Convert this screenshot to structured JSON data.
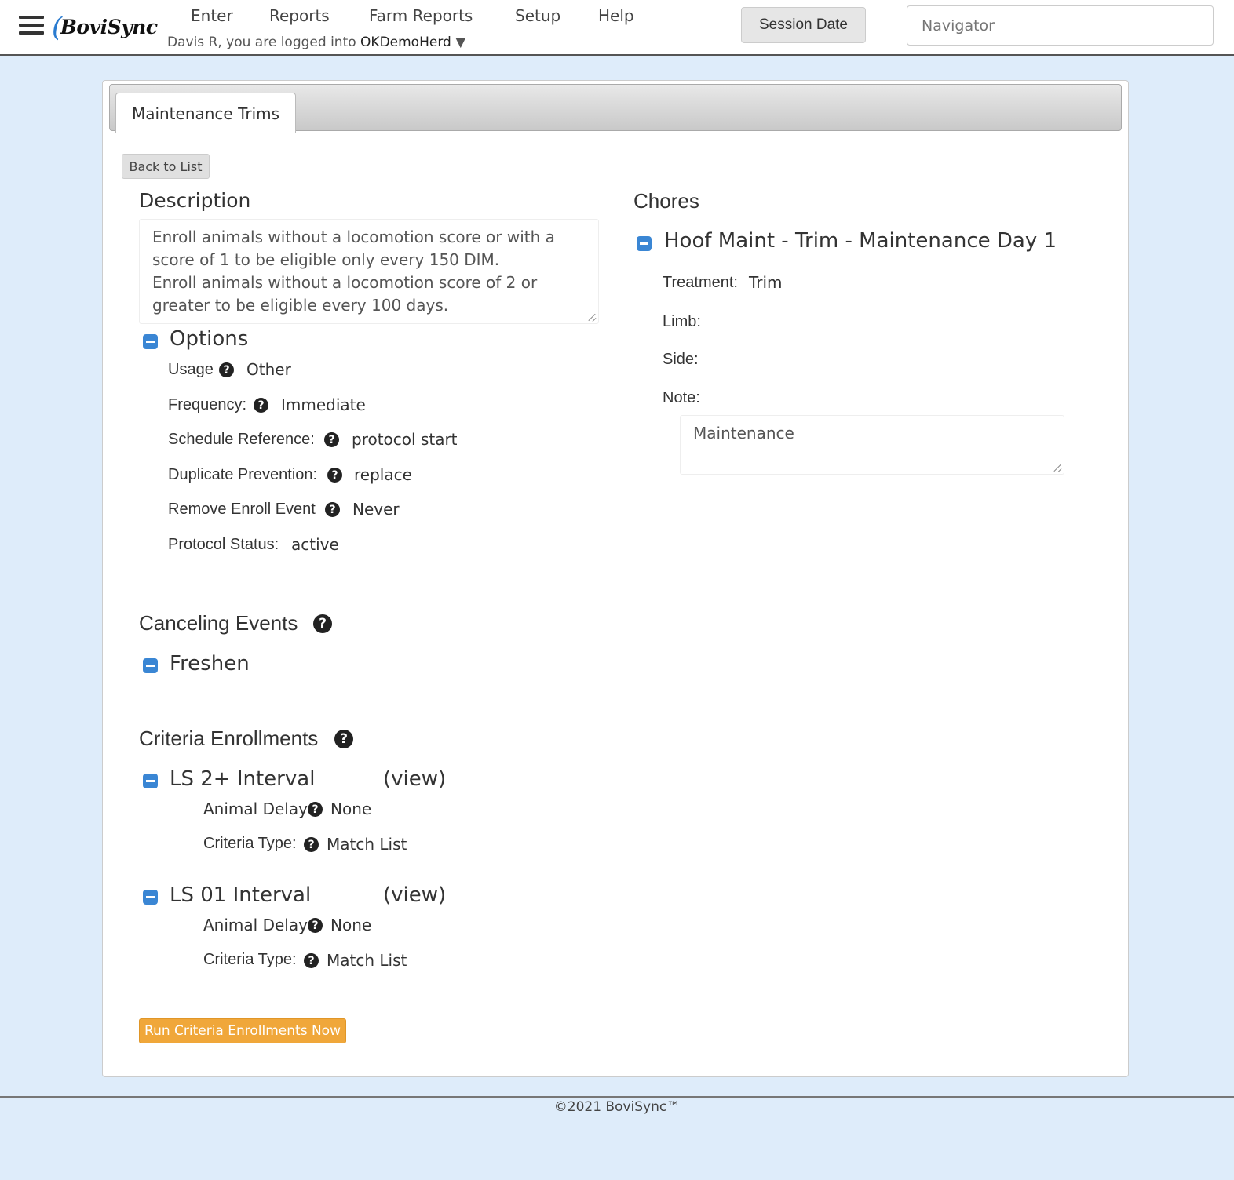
{
  "header": {
    "logo_text": "BoviSync",
    "nav": [
      "Enter",
      "Reports",
      "Farm Reports",
      "Setup",
      "Help"
    ],
    "login_prefix": "Davis R, you are logged into",
    "herd": "OKDemoHerd",
    "herd_caret": "▼",
    "session_date": "Session Date",
    "navigator_placeholder": "Navigator"
  },
  "tab": {
    "label": "Maintenance Trims"
  },
  "back_label": "Back to List",
  "description": {
    "heading": "Description",
    "text": "Enroll animals without a locomotion score or with a score of 1 to be eligible only every 150 DIM.\nEnroll animals without a locomotion score of 2 or greater to be eligible every 100 days."
  },
  "options": {
    "heading": "Options",
    "rows": [
      {
        "label": "Usage",
        "value": "Other"
      },
      {
        "label": "Frequency:",
        "value": "Immediate"
      },
      {
        "label": "Schedule Reference:",
        "value": "protocol start"
      },
      {
        "label": "Duplicate Prevention:",
        "value": "replace"
      },
      {
        "label": "Remove Enroll Event",
        "value": "Never"
      },
      {
        "label": "Protocol Status:",
        "value": "active"
      }
    ]
  },
  "canceling": {
    "heading": "Canceling Events",
    "items": [
      "Freshen"
    ]
  },
  "criteria": {
    "heading": "Criteria Enrollments",
    "items": [
      {
        "name": "LS 2+ Interval",
        "view": "(view)",
        "delay_label": "Animal Delay",
        "delay": "None",
        "type_label": "Criteria Type:",
        "type": "Match List"
      },
      {
        "name": "LS 01 Interval",
        "view": "(view)",
        "delay_label": "Animal Delay",
        "delay": "None",
        "type_label": "Criteria Type:",
        "type": "Match List"
      }
    ],
    "run_button": "Run Criteria Enrollments Now"
  },
  "chores": {
    "heading": "Chores",
    "title": "Hoof Maint - Trim - Maintenance Day 1",
    "treatment_label": "Treatment:",
    "treatment": "Trim",
    "limb_label": "Limb:",
    "side_label": "Side:",
    "note_label": "Note:",
    "note": "Maintenance"
  },
  "footer": "©2021 BoviSync™",
  "icons": {
    "help": "?"
  },
  "colors": {
    "accent": "#3a86d4",
    "run_button": "#f0a73a",
    "background": "#deecfa"
  }
}
